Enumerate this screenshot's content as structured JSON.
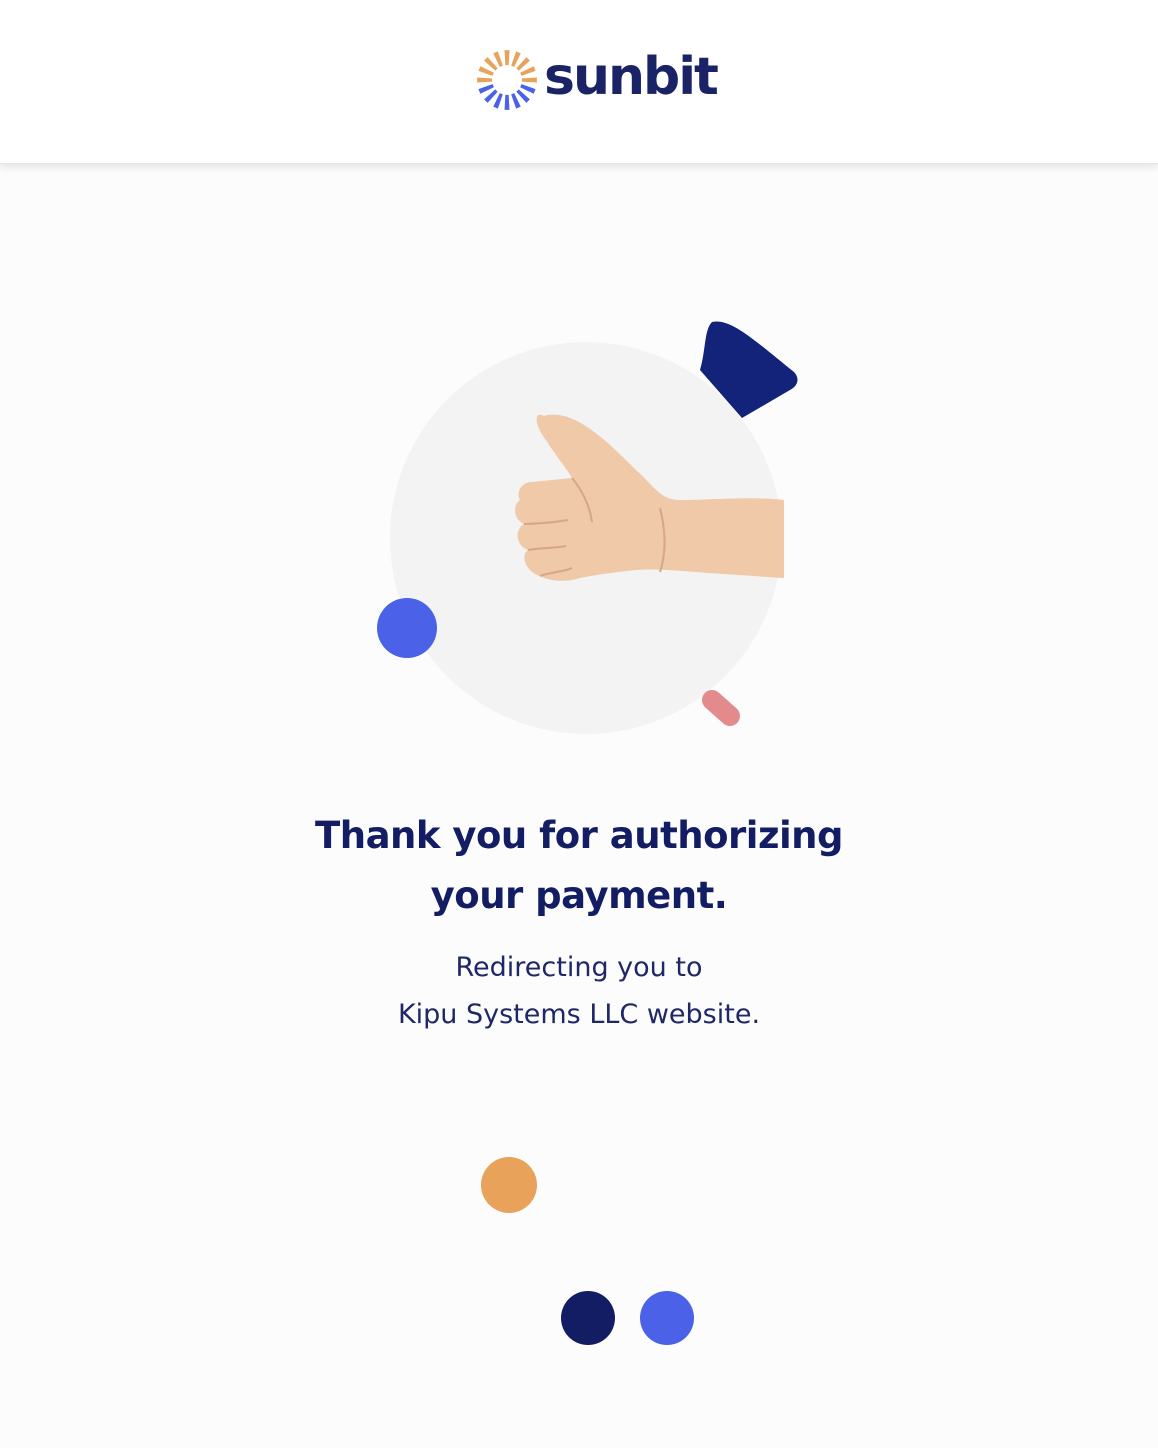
{
  "brand": {
    "name": "sunbit",
    "logo_icon": "sunburst-logo-icon",
    "text_color": "#1a2366",
    "ray_colors": [
      "#e8a25a",
      "#4a61e8"
    ]
  },
  "illustration": {
    "subject": "thumbs-up-hand-icon",
    "circle_color": "#f3f3f4",
    "accent_colors": {
      "navy_shape": "#14237a",
      "blue_dot": "#4a61e8",
      "pink_shape": "#e38a8c"
    }
  },
  "message": {
    "headline_line1": "Thank you for authorizing",
    "headline_line2": "your payment.",
    "subtext_line1": "Redirecting you to",
    "subtext_line2": "Kipu Systems LLC website.",
    "headline_color": "#131d64",
    "subtext_color": "#1f2766"
  },
  "loader": {
    "dot_colors": [
      "#e8a25a",
      "#131d64",
      "#4a61e8"
    ]
  }
}
